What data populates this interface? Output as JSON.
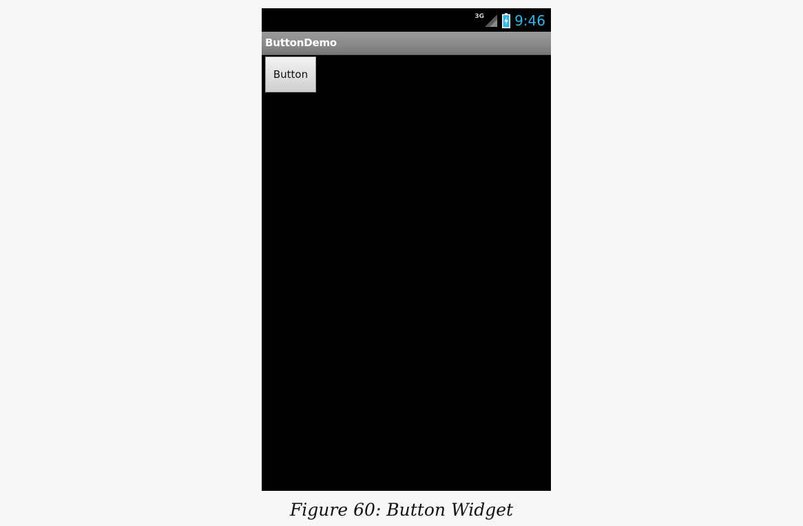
{
  "status_bar": {
    "network_type": "3G",
    "clock": "9:46",
    "signal_icon": "signal-icon",
    "battery_icon": "battery-charging-icon",
    "accent_color": "#33b5e5"
  },
  "app": {
    "title": "ButtonDemo"
  },
  "content": {
    "button_label": "Button"
  },
  "caption": "Figure 60: Button Widget"
}
